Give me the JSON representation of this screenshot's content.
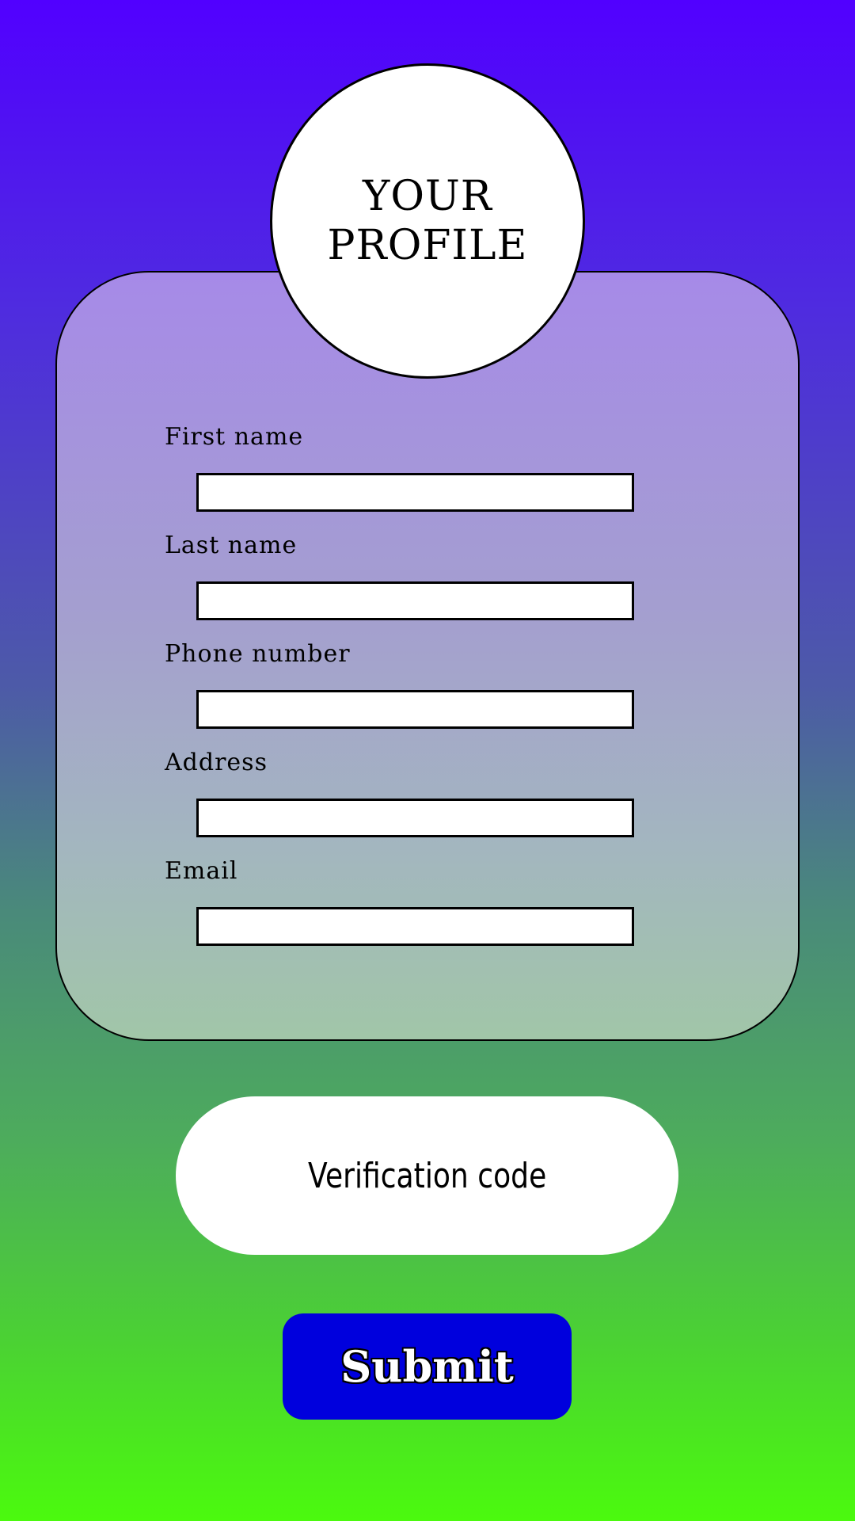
{
  "profile": {
    "title": "YOUR\nPROFILE"
  },
  "form": {
    "fields": [
      {
        "label": "First name",
        "value": "",
        "placeholder": ""
      },
      {
        "label": "Last name",
        "value": "",
        "placeholder": ""
      },
      {
        "label": "Phone number",
        "value": "",
        "placeholder": ""
      },
      {
        "label": "Address",
        "value": "",
        "placeholder": ""
      },
      {
        "label": "Email",
        "value": "",
        "placeholder": ""
      }
    ]
  },
  "verification": {
    "label": "Verification code"
  },
  "submit": {
    "label": "Submit"
  },
  "colors": {
    "background_top": "#5100ff",
    "background_bottom": "#4bfa0e",
    "card_top": "#a68ae8",
    "card_bottom": "#a1c6a8",
    "submit_button": "#0000dd"
  }
}
